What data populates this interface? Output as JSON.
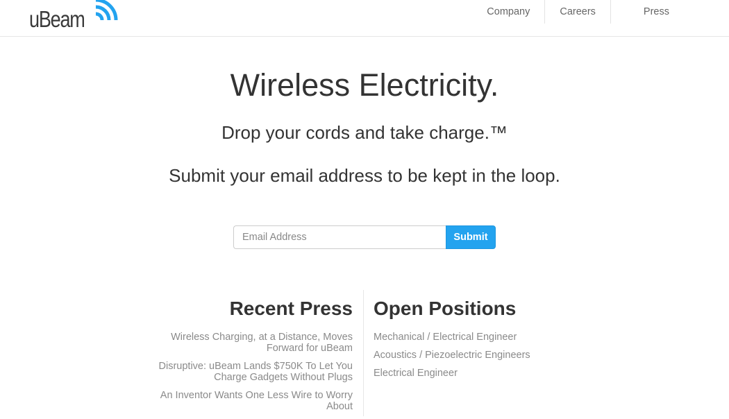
{
  "brand": {
    "logo_text": "uBeam",
    "accent_color": "#23a3ef"
  },
  "nav": {
    "items": [
      {
        "label": "Company"
      },
      {
        "label": "Careers"
      },
      {
        "label": "Press"
      }
    ]
  },
  "hero": {
    "title": "Wireless Electricity.",
    "tagline": "Drop your cords and take charge.™",
    "subtitle": "Submit your email address to be kept in the loop."
  },
  "signup": {
    "email_placeholder": "Email Address",
    "email_value": "",
    "submit_label": "Submit"
  },
  "press": {
    "heading": "Recent Press",
    "items": [
      {
        "label": "Wireless Charging, at a Distance, Moves Forward for uBeam"
      },
      {
        "label": "Disruptive: uBeam Lands $750K To Let You Charge Gadgets Without Plugs"
      },
      {
        "label": "An Inventor Wants One Less Wire to Worry About"
      }
    ]
  },
  "positions": {
    "heading": "Open Positions",
    "items": [
      {
        "label": "Mechanical / Electrical Engineer"
      },
      {
        "label": "Acoustics / Piezoelectric Engineers"
      },
      {
        "label": "Electrical Engineer"
      }
    ]
  }
}
